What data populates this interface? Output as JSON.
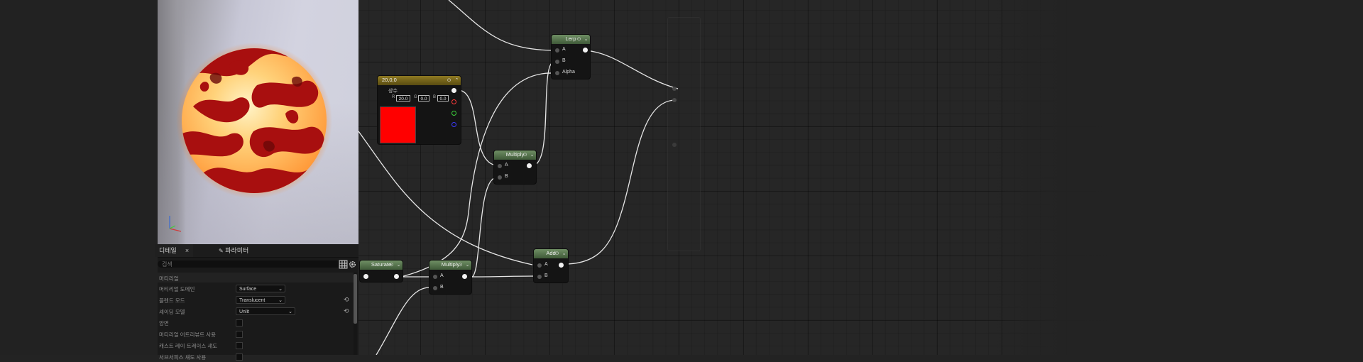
{
  "details_tabs": [
    {
      "label": "디테일",
      "close": "×"
    },
    {
      "label": "파라미터"
    }
  ],
  "search": {
    "placeholder": "검색"
  },
  "material_section": {
    "label": "머티리얼"
  },
  "properties": [
    {
      "label": "머티리얼 도메인",
      "value": "Surface"
    },
    {
      "label": "블렌드 모드",
      "value": "Translucent",
      "reset": "⟲"
    },
    {
      "label": "셰이딩 모델",
      "value": "Unlit",
      "reset": "⟲"
    },
    {
      "label": "양면"
    },
    {
      "label": "머티리얼 어트리뷰트 사용"
    },
    {
      "label": "캐스트 레이 트레이스 섀도"
    },
    {
      "label": "서브서피스 섀도 사용"
    }
  ],
  "nodes": {
    "lerp": {
      "title": "Lerp",
      "pins": [
        "A",
        "B",
        "Alpha"
      ]
    },
    "constant": {
      "title": "20,0,0",
      "subtitle": "상수",
      "r_label": "R",
      "g_label": "G",
      "b_label": "B",
      "r": "20.0",
      "g": "0.0",
      "b": "0.0"
    },
    "multiply_top": {
      "title": "Multiply",
      "pins": [
        "A",
        "B"
      ]
    },
    "saturate": {
      "title": "Saturate"
    },
    "multiply_bottom": {
      "title": "Multiply",
      "pins": [
        "A",
        "B"
      ]
    },
    "add": {
      "title": "Add",
      "pins": [
        "A",
        "B"
      ]
    }
  },
  "colors": {
    "math_header": "#5a7a52",
    "const_header": "#7a6a1c",
    "swatch": "#ff0000",
    "pin_red": "#ff3b3b",
    "pin_green": "#3bd13b",
    "pin_blue": "#3b3bff"
  }
}
